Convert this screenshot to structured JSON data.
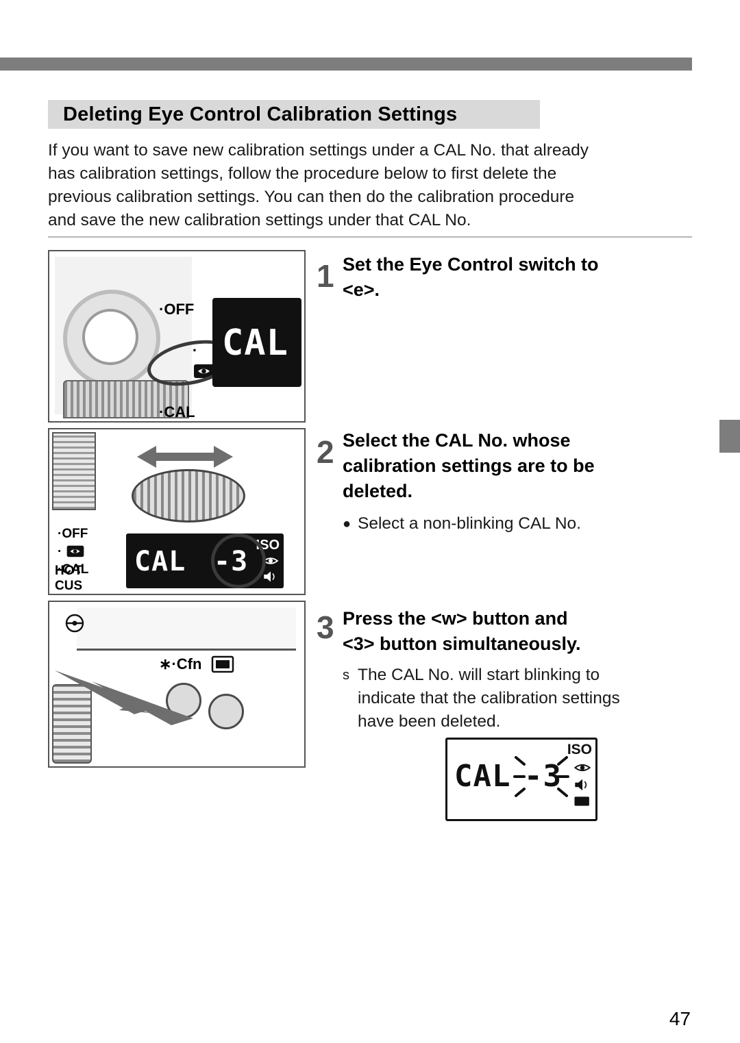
{
  "document": {
    "title": "Deleting Eye Control Calibration Settings",
    "page_number": "47",
    "intro_lines": [
      "If you want to save new calibration settings under a CAL No. that already",
      "has calibration settings, follow the procedure below to first delete the",
      "previous calibration settings. You can then do the calibration procedure",
      "and save the new calibration settings under that CAL No."
    ]
  },
  "steps": [
    {
      "number": "1",
      "heading_lines": [
        "Set the Eye Control switch to",
        "<e>."
      ],
      "body_lines": [],
      "bullets": []
    },
    {
      "number": "2",
      "heading_lines": [
        "Select the CAL No. whose",
        "calibration settings are to be",
        "deleted."
      ],
      "body_lines": [],
      "bullets": [
        {
          "marker": "●",
          "text": "Select a non-blinking CAL No."
        }
      ]
    },
    {
      "number": "3",
      "heading_lines": [
        "Press the <w> button and",
        "<3> button simultaneously."
      ],
      "body_lines": [
        "The CAL No. will start blinking to",
        "indicate that the calibration settings",
        "have been deleted."
      ],
      "bullets": [
        {
          "marker": "s",
          "text": "The CAL No. will start blinking to"
        }
      ]
    }
  ],
  "figures": {
    "figure1": {
      "name": "eye-control-switch-dial",
      "switch_labels": [
        "·OFF",
        "·",
        "·CAL"
      ],
      "lcd_text": "CAL"
    },
    "figure2": {
      "name": "select-cal-number-dial",
      "switch_labels": [
        "·OFF",
        "·",
        "·CAL"
      ],
      "hot_shoe_label": [
        "HOT",
        "CUS"
      ],
      "lcd_text": "CAL",
      "lcd_number": "-3",
      "iso_label": "ISO"
    },
    "figure3": {
      "name": "press-buttons-simultaneously",
      "button_marks": "∗·Cfn"
    },
    "lcd_result": {
      "name": "lcd-blinking-cal-number",
      "lcd_text": "CAL",
      "lcd_number": "-3",
      "iso_label": "ISO"
    }
  },
  "colors": {
    "bar": "#7d7d7d",
    "title_bg": "#d9d9d9",
    "step_number": "#555555",
    "text": "#000000"
  }
}
